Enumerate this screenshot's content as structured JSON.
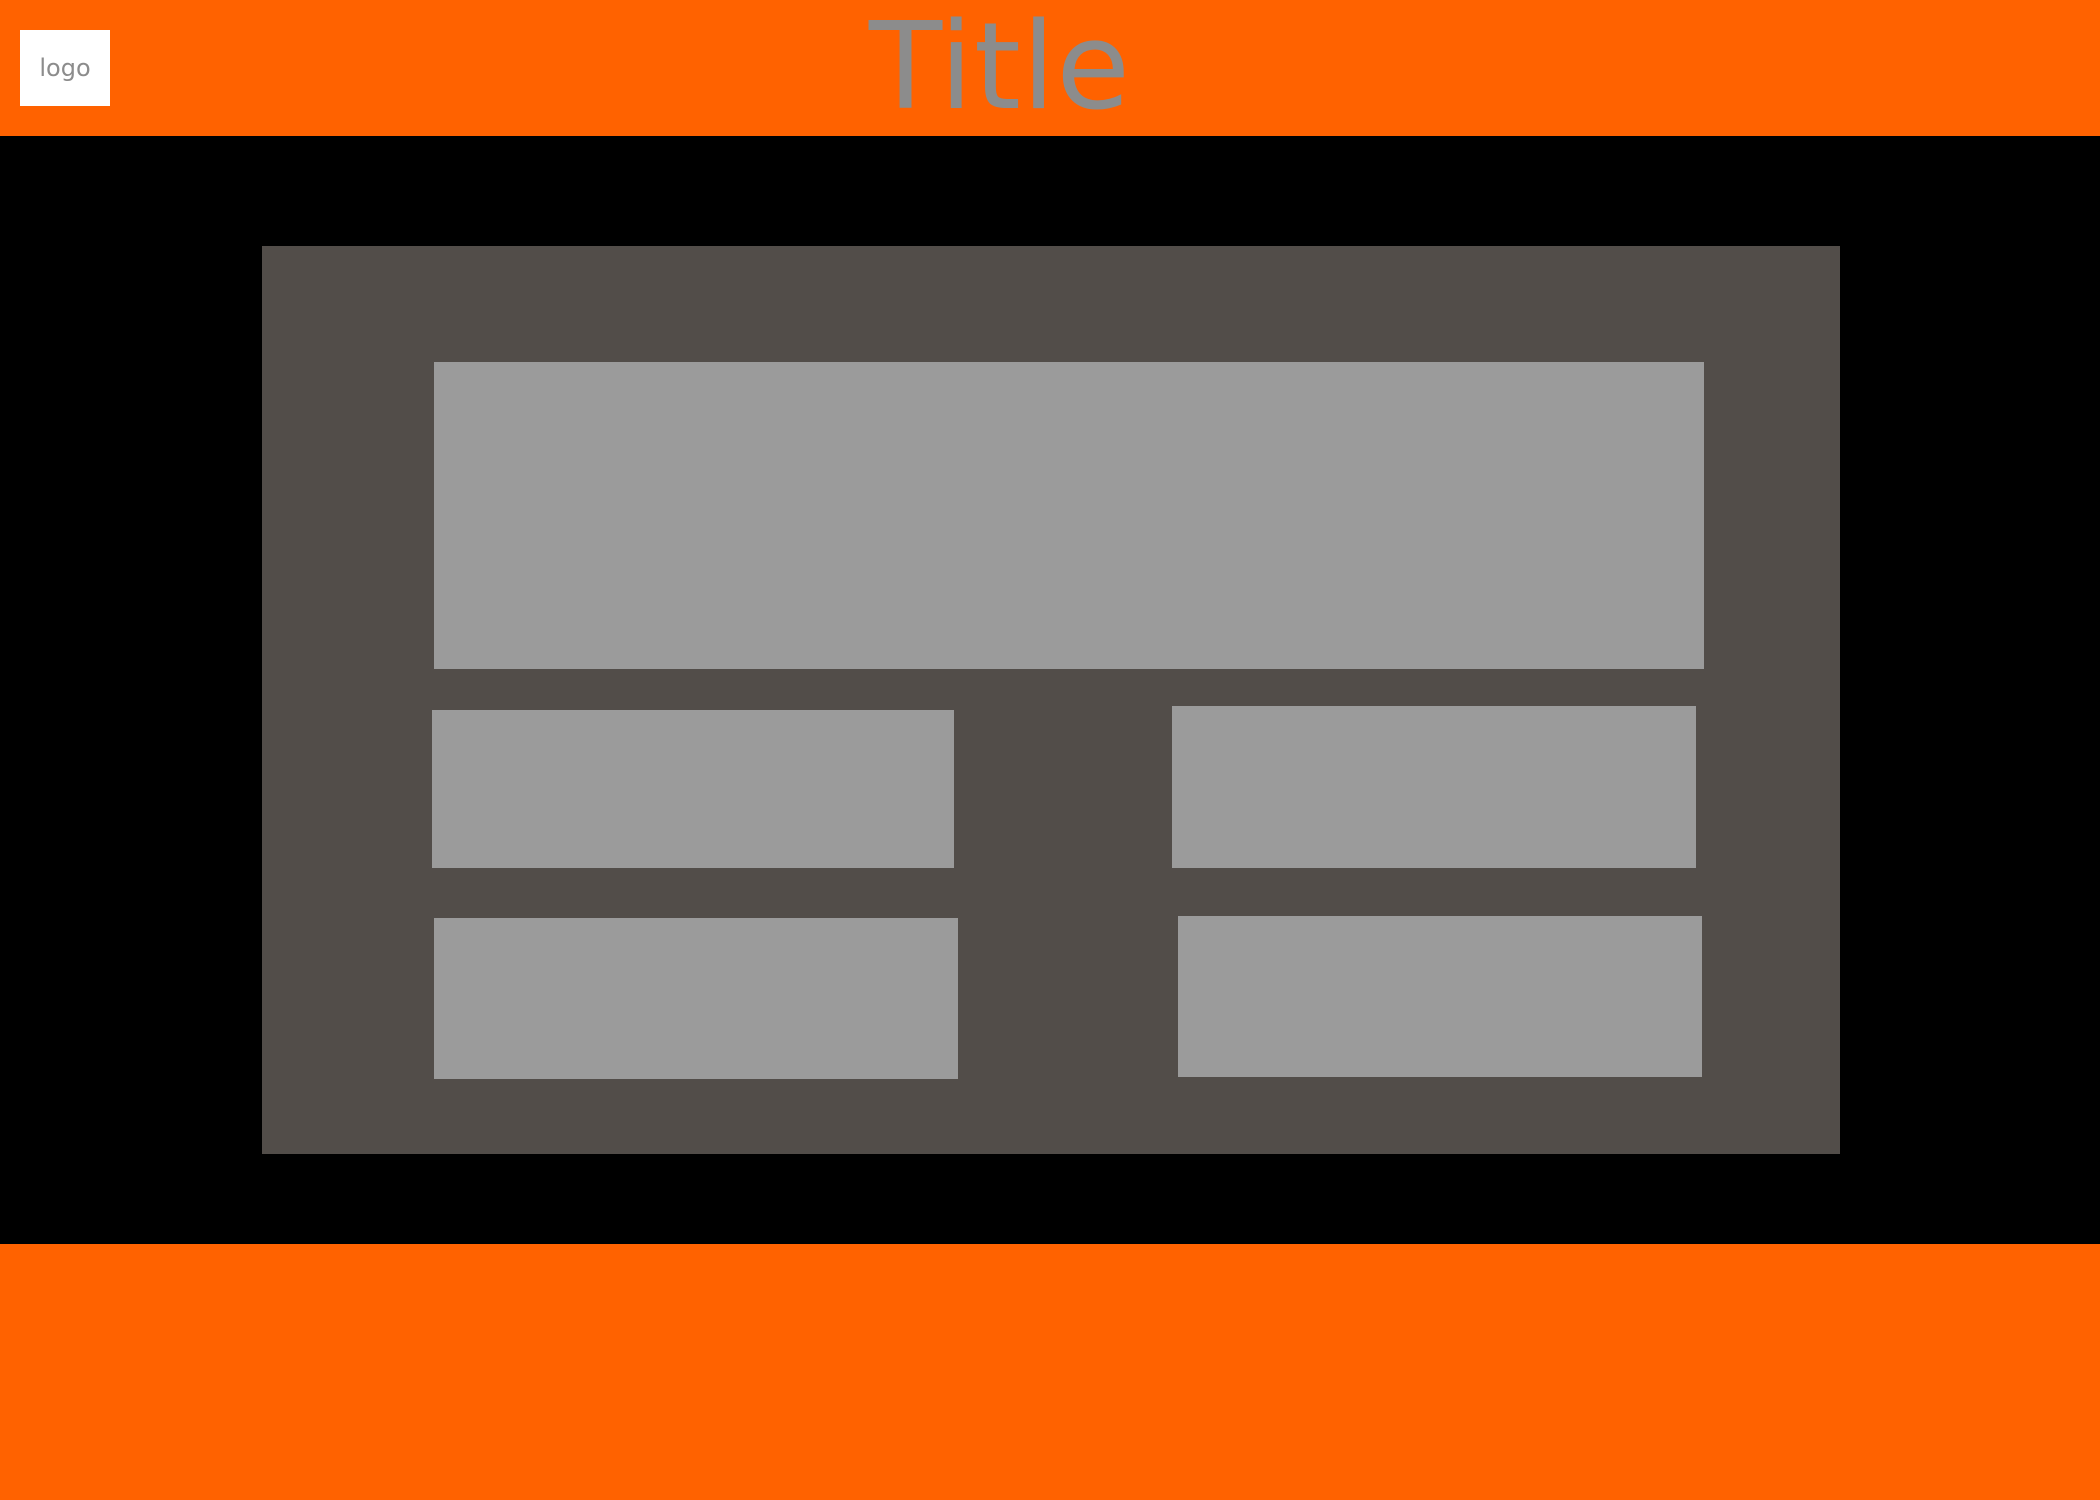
{
  "header": {
    "logo_text": "logo",
    "title": "Title"
  },
  "colors": {
    "header_background": "#ff6200",
    "footer_background": "#ff6200",
    "page_background": "#000000",
    "panel_background": "#524d49",
    "placeholder_box": "#9b9b9b",
    "text_gray": "#8c8c8c",
    "logo_background": "#ffffff"
  }
}
